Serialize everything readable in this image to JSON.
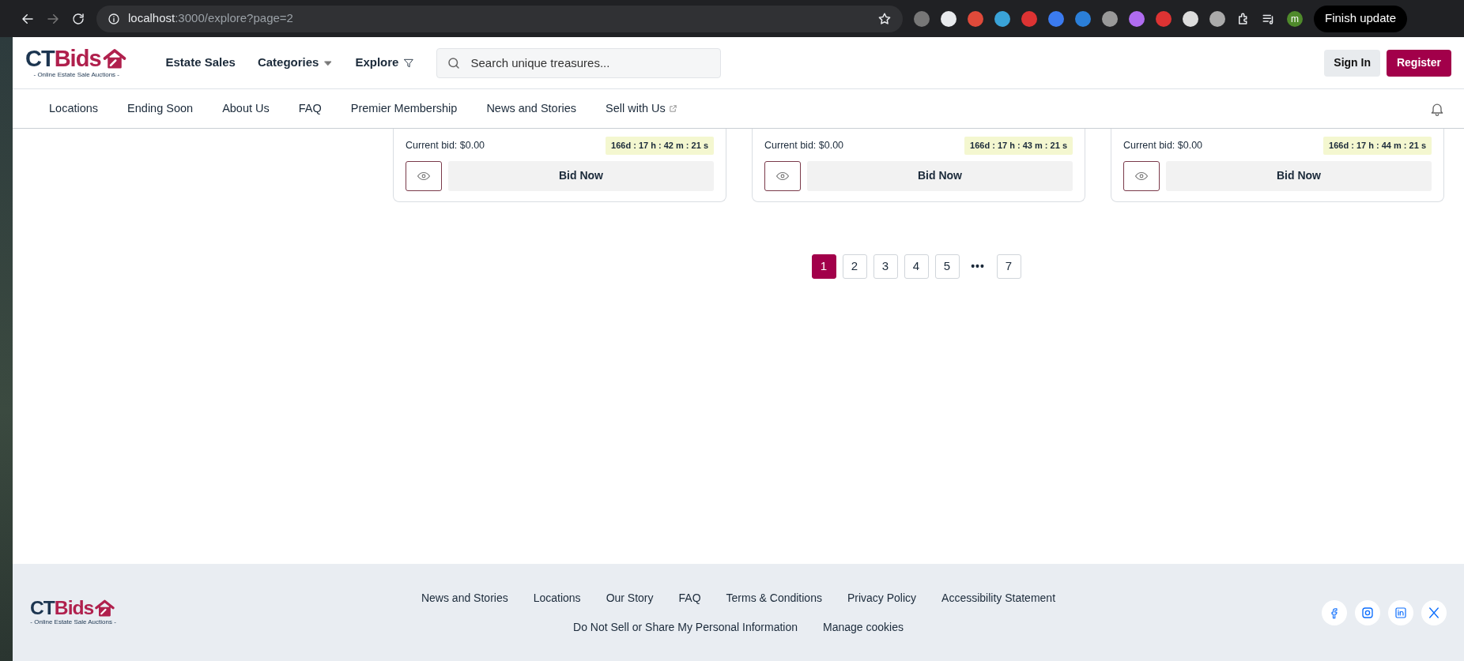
{
  "browser": {
    "url_host": "localhost",
    "url_rest": ":3000/explore?page=2",
    "profile": "m",
    "update_button": "Finish update"
  },
  "header": {
    "logo": {
      "name": "CTBids",
      "tagline": "- Online Estate Sale Auctions -"
    },
    "menu": [
      {
        "label": "Estate Sales",
        "kind": "plain"
      },
      {
        "label": "Categories",
        "kind": "dropdown"
      },
      {
        "label": "Explore",
        "kind": "filter"
      }
    ],
    "search": {
      "placeholder": "Search unique treasures..."
    },
    "buttons": [
      {
        "label": "Sign In",
        "kind": "secondary"
      },
      {
        "label": "Register",
        "kind": "primary"
      }
    ]
  },
  "subnav": [
    {
      "label": "Locations",
      "external": false
    },
    {
      "label": "Ending Soon",
      "external": false
    },
    {
      "label": "About Us",
      "external": false
    },
    {
      "label": "FAQ",
      "external": false
    },
    {
      "label": "Premier Membership",
      "external": false
    },
    {
      "label": "News and Stories",
      "external": false
    },
    {
      "label": "Sell with Us",
      "external": true
    }
  ],
  "cards": [
    {
      "bid": "Current bid: $0.00",
      "countdown": "166d : 17 h : 42 m : 21 s",
      "button": "Bid Now"
    },
    {
      "bid": "Current bid: $0.00",
      "countdown": "166d : 17 h : 43 m : 21 s",
      "button": "Bid Now"
    },
    {
      "bid": "Current bid: $0.00",
      "countdown": "166d : 17 h : 44 m : 21 s",
      "button": "Bid Now"
    }
  ],
  "pagination": [
    {
      "label": "1",
      "selected": true,
      "kind": "page"
    },
    {
      "label": "2",
      "selected": false,
      "kind": "page"
    },
    {
      "label": "3",
      "selected": false,
      "kind": "page"
    },
    {
      "label": "4",
      "selected": false,
      "kind": "page"
    },
    {
      "label": "5",
      "selected": false,
      "kind": "page"
    },
    {
      "label": "•••",
      "kind": "ellipsis"
    },
    {
      "label": "7",
      "selected": false,
      "kind": "page"
    }
  ],
  "footer": {
    "logo": {
      "name": "CTBids",
      "tagline": "- Online Estate Sale Auctions -"
    },
    "links": [
      "News and Stories",
      "Locations",
      "Our Story",
      "FAQ",
      "Terms & Conditions",
      "Privacy Policy",
      "Accessibility Statement"
    ],
    "links_2": [
      "Do Not Sell or Share My Personal Information",
      "Manage cookies"
    ],
    "social": [
      {
        "kind": "facebook"
      },
      {
        "kind": "instagram"
      },
      {
        "kind": "linkedin"
      },
      {
        "kind": "x"
      }
    ]
  }
}
